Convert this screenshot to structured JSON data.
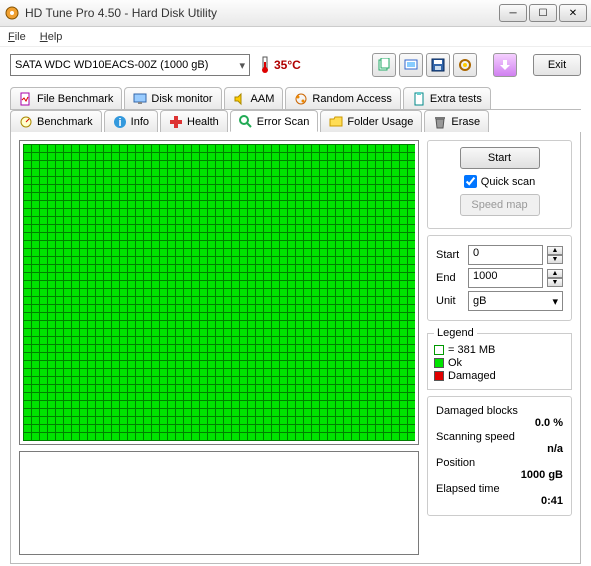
{
  "window": {
    "title": "HD Tune Pro 4.50 - Hard Disk Utility"
  },
  "menu": {
    "file": "File",
    "help": "Help"
  },
  "toolbar": {
    "drive": "SATA   WDC WD10EACS-00Z (1000 gB)",
    "temp": "35°C",
    "exit": "Exit"
  },
  "tabs_top": [
    {
      "label": "File Benchmark"
    },
    {
      "label": "Disk monitor"
    },
    {
      "label": "AAM"
    },
    {
      "label": "Random Access"
    },
    {
      "label": "Extra tests"
    }
  ],
  "tabs_bottom": [
    {
      "label": "Benchmark"
    },
    {
      "label": "Info"
    },
    {
      "label": "Health"
    },
    {
      "label": "Error Scan"
    },
    {
      "label": "Folder Usage"
    },
    {
      "label": "Erase"
    }
  ],
  "panel": {
    "start_btn": "Start",
    "quick_scan": "Quick scan",
    "speed_map": "Speed map",
    "start_label": "Start",
    "start_val": "0",
    "end_label": "End",
    "end_val": "1000",
    "unit_label": "Unit",
    "unit_val": "gB",
    "legend_title": "Legend",
    "legend_block": "= 381 MB",
    "legend_ok": "Ok",
    "legend_damaged": "Damaged",
    "damaged_blocks_label": "Damaged blocks",
    "damaged_blocks_val": "0.0 %",
    "scanning_speed_label": "Scanning speed",
    "scanning_speed_val": "n/a",
    "position_label": "Position",
    "position_val": "1000 gB",
    "elapsed_label": "Elapsed time",
    "elapsed_val": "0:41"
  }
}
